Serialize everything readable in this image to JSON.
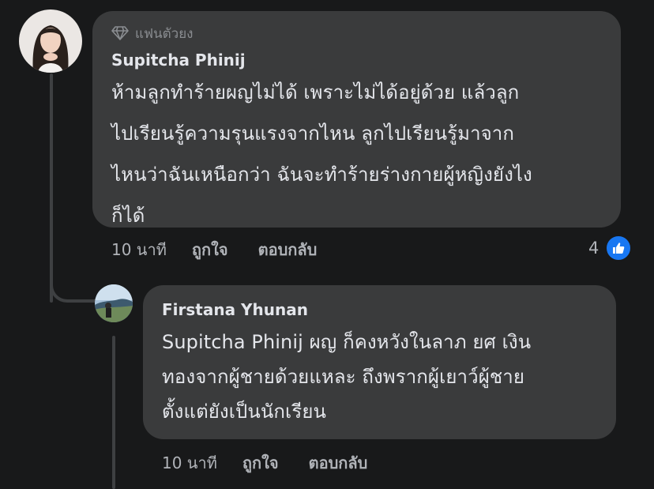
{
  "comments": [
    {
      "badge": "แฟนตัวยง",
      "author": "Supitcha Phinij",
      "text": "ห้ามลูกทำร้ายผญไม่ได้ เพราะไม่ได้อยู่ด้วย แล้วลูก\nไปเรียนรู้ความรุนแรงจากไหน ลูกไปเรียนรู้มาจาก\nไหนว่าฉันเหนือกว่า ฉันจะทำร้ายร่างกายผู้หญิงยังไง\nก็ได้",
      "time": "10 นาที",
      "like_label": "ถูกใจ",
      "reply_label": "ตอบกลับ",
      "reaction_count": "4",
      "reaction_icon": "thumbs-up-icon",
      "reaction_color": "#1877f2"
    }
  ],
  "replies": [
    {
      "author": "Firstana Yhunan",
      "text": "Supitcha Phinij  ผญ ก็คงหวังในลาภ ยศ เงิน\nทองจากผู้ชายด้วยแหละ ถึงพรากผู้เยาว์ผู้ชาย\nตั้งแต่ยังเป็นนักเรียน",
      "time": "10 นาที",
      "like_label": "ถูกใจ",
      "reply_label": "ตอบกลับ"
    }
  ],
  "colors": {
    "background": "#18191a",
    "bubble": "#3a3b3c",
    "primary_text": "#e4e6eb",
    "secondary_text": "#b0b3b8"
  }
}
